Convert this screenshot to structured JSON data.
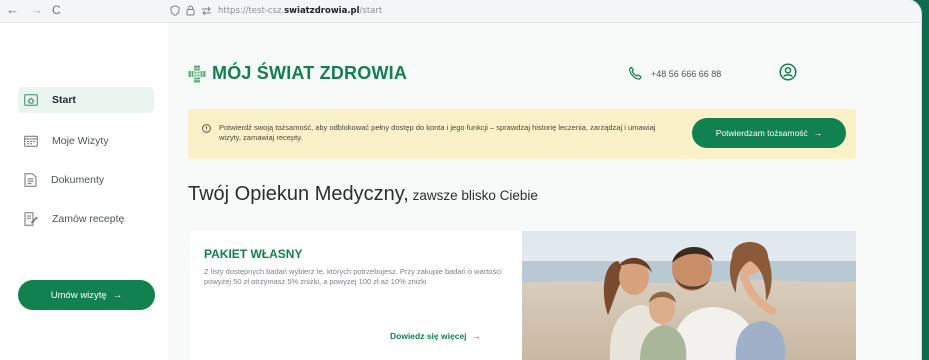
{
  "browser": {
    "url_prefix": "https://test-csz.",
    "url_host": "swiatzdrowia.pl",
    "url_path": "/start",
    "back_glyph": "←",
    "forward_glyph": "→",
    "reload_glyph": "C"
  },
  "sidebar": {
    "items": [
      {
        "label": "Start",
        "icon": "home-icon",
        "active": true
      },
      {
        "label": "Moje Wizyty",
        "icon": "calendar-icon"
      },
      {
        "label": "Dokumenty",
        "icon": "document-icon"
      },
      {
        "label": "Zamów receptę",
        "icon": "prescription-icon"
      }
    ],
    "cta_label": "Umów wizytę",
    "cta_arrow": "→"
  },
  "header": {
    "logo_text": "MÓJ ŚWIAT ZDROWIA",
    "phone": "+48 56 666 66 88"
  },
  "banner": {
    "text": "Potwierdź swoją tożsamość, aby odblokować pełny dostęp do konta i jego funkcji – sprawdzaj historię leczenia, zarządzaj i umawiaj wizyty, zamawiaj recepty.",
    "button_label": "Potwierdzam tożsamość",
    "button_arrow": "→"
  },
  "headline": {
    "big": "Twój Opiekun Medyczny,",
    "small": " zawsze blisko Ciebie"
  },
  "card": {
    "title": "PAKIET WŁASNY",
    "description": "Z listy dostępnych badań wybierz te, których potrzebujesz. Przy zakupie badań o wartości powyżej 50 zł otrzymasz 5% zniżki, a powyżej 100 zł aż 10% zniżki",
    "link_label": "Dowiedz się więcej",
    "link_arrow": "→"
  },
  "colors": {
    "brand_green": "#12804e",
    "banner_bg": "#fbf1c9",
    "sidebar_active_bg": "#eaf5ef"
  }
}
